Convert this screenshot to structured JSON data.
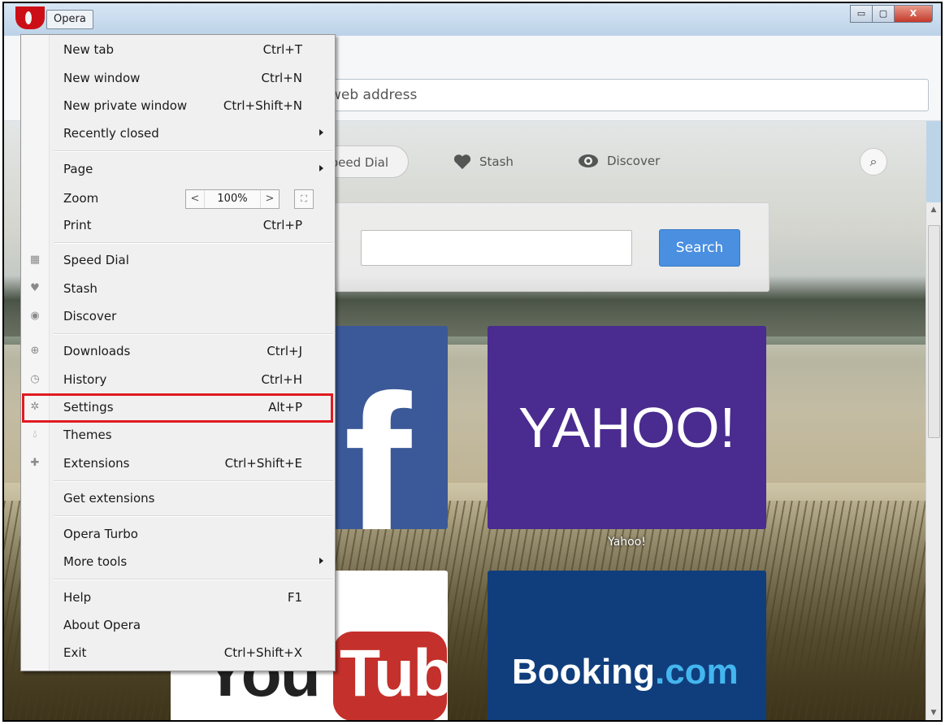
{
  "window": {
    "app_button": "Opera",
    "buttons": {
      "minimize": "▭",
      "maximize": "▢",
      "close": "X"
    }
  },
  "address_bar": {
    "placeholder": "web address"
  },
  "speed_dial_nav": {
    "speed_dial": "peed Dial",
    "stash": "Stash",
    "discover": "Discover"
  },
  "search_panel": {
    "button": "Search"
  },
  "tiles": [
    {
      "name": "Facebook",
      "glyph": "f"
    },
    {
      "name": "Yahoo!",
      "logo": "YAHOO!",
      "caption": "Yahoo!"
    },
    {
      "name": "YouTube",
      "logo_a": "You",
      "logo_b": "Tube"
    },
    {
      "name": "Booking.com",
      "logo_a": "Booking",
      "logo_b": ".com"
    }
  ],
  "menu": {
    "items": [
      {
        "label": "New tab",
        "shortcut": "Ctrl+T"
      },
      {
        "label": "New window",
        "shortcut": "Ctrl+N"
      },
      {
        "label": "New private window",
        "shortcut": "Ctrl+Shift+N"
      },
      {
        "label": "Recently closed",
        "submenu": true
      },
      {
        "label": "Page",
        "submenu": true
      },
      {
        "label": "Zoom",
        "zoom_value": "100%",
        "zoom_minus": "<",
        "zoom_plus": ">"
      },
      {
        "label": "Print",
        "shortcut": "Ctrl+P"
      },
      {
        "label": "Speed Dial",
        "icon": "speed-dial-icon"
      },
      {
        "label": "Stash",
        "icon": "heart-icon"
      },
      {
        "label": "Discover",
        "icon": "eye-icon"
      },
      {
        "label": "Downloads",
        "shortcut": "Ctrl+J",
        "icon": "download-icon"
      },
      {
        "label": "History",
        "shortcut": "Ctrl+H",
        "icon": "clock-icon"
      },
      {
        "label": "Settings",
        "shortcut": "Alt+P",
        "icon": "gear-icon",
        "highlighted": true
      },
      {
        "label": "Themes",
        "icon": "drop-icon"
      },
      {
        "label": "Extensions",
        "shortcut": "Ctrl+Shift+E",
        "icon": "puzzle-icon"
      },
      {
        "label": "Get extensions"
      },
      {
        "label": "Opera Turbo"
      },
      {
        "label": "More tools",
        "submenu": true
      },
      {
        "label": "Help",
        "shortcut": "F1"
      },
      {
        "label": "About Opera"
      },
      {
        "label": "Exit",
        "shortcut": "Ctrl+Shift+X"
      }
    ]
  },
  "colors": {
    "highlight_border": "#e01a22",
    "search_button": "#4a8fe0",
    "facebook": "#3b5998",
    "yahoo": "#4a2b8f",
    "booking": "#103e7d",
    "opera_red": "#cc0f16"
  }
}
